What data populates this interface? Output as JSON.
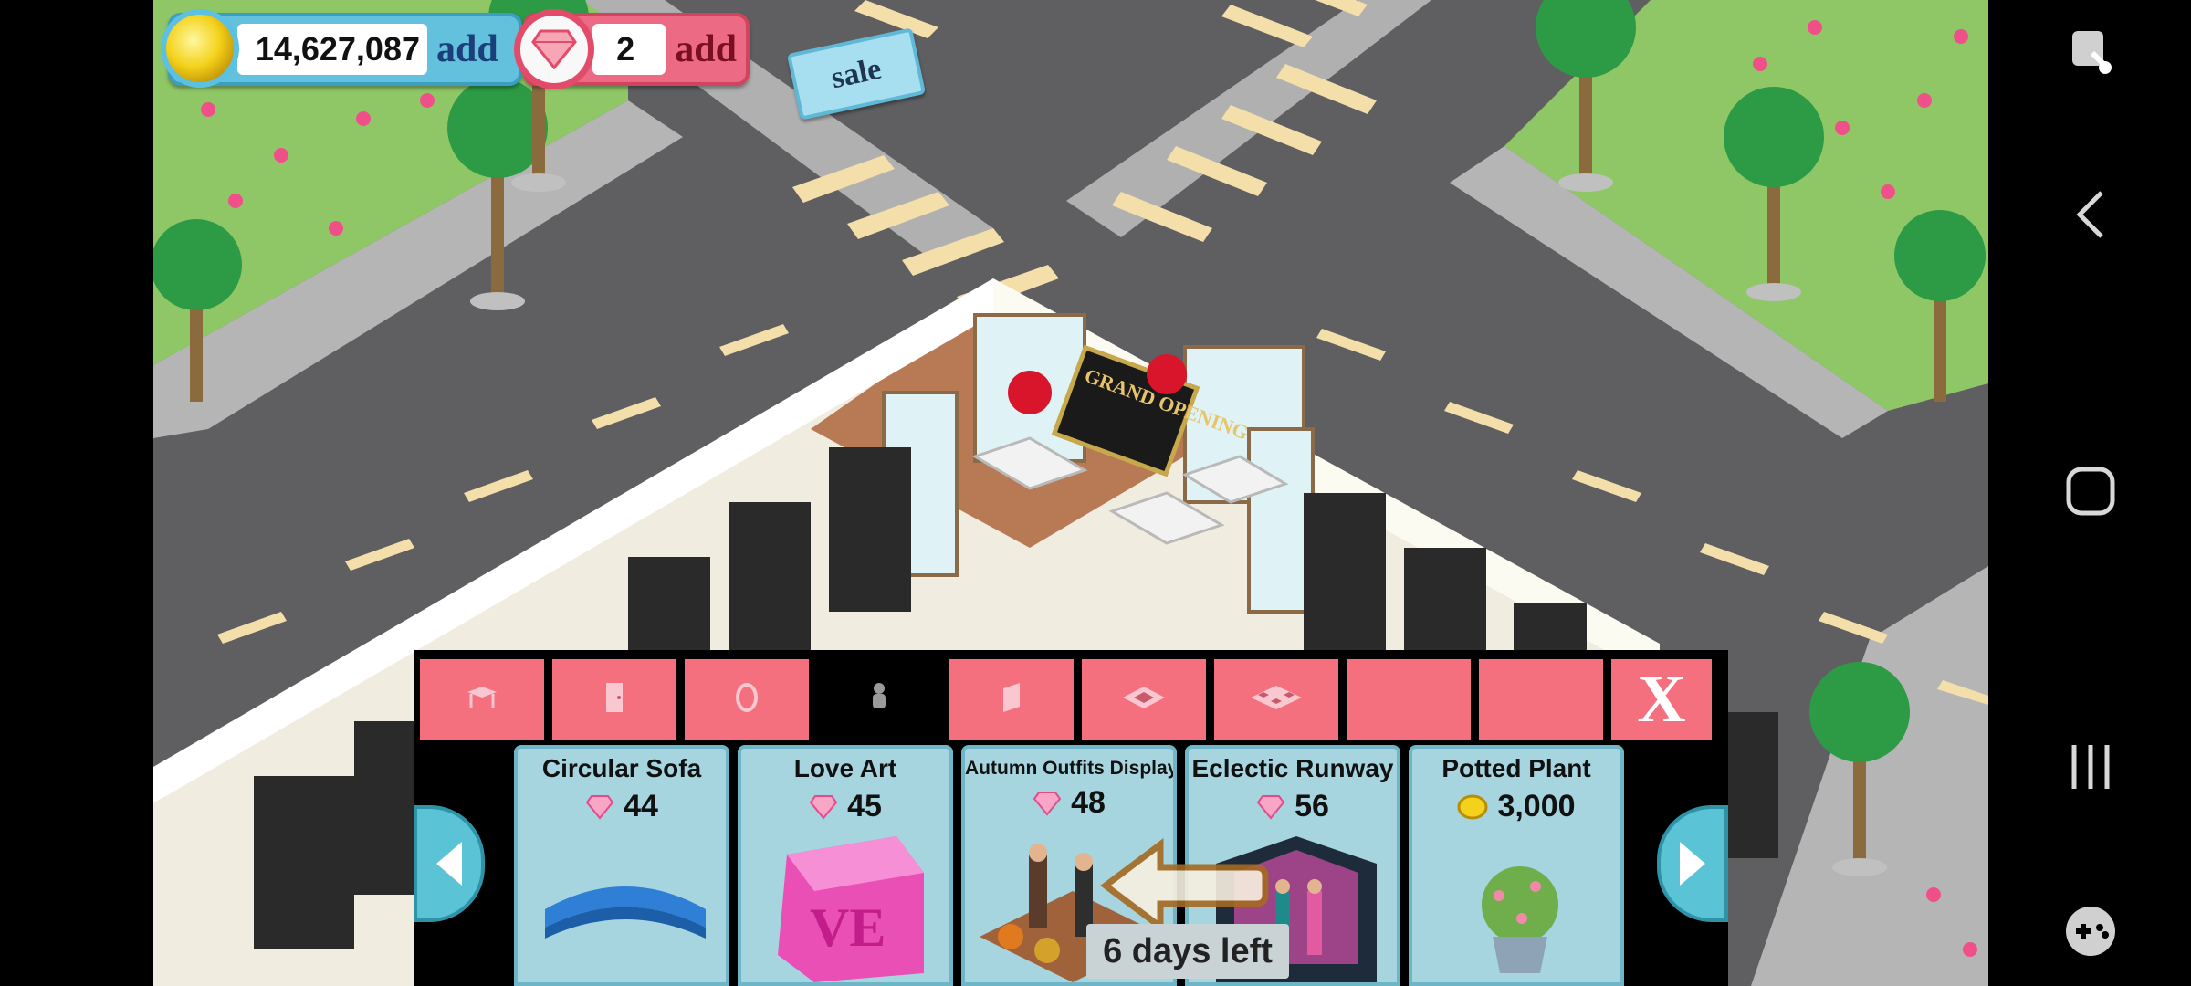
{
  "hud": {
    "coins_value": "14,627,087",
    "coins_add_label": "add",
    "gems_value": "2",
    "gems_add_label": "add",
    "sale_label": "sale"
  },
  "shop": {
    "tabs": [
      {
        "icon": "table-icon",
        "active": false
      },
      {
        "icon": "door-icon",
        "active": false
      },
      {
        "icon": "clock-icon",
        "active": false
      },
      {
        "icon": "mannequin-icon",
        "active": true
      },
      {
        "icon": "wallpaper-icon",
        "active": false
      },
      {
        "icon": "floor-tile-icon",
        "active": false
      },
      {
        "icon": "floor-pattern-icon",
        "active": false
      },
      {
        "icon": "empty-tab",
        "active": false
      },
      {
        "icon": "empty-tab",
        "active": false
      }
    ],
    "close_label": "X",
    "items": [
      {
        "name": "Circular Sofa",
        "currency": "gem",
        "price": "44"
      },
      {
        "name": "Love Art",
        "currency": "gem",
        "price": "45"
      },
      {
        "name": "Autumn Outfits Display",
        "currency": "gem",
        "price": "48"
      },
      {
        "name": "Eclectic Runway",
        "currency": "gem",
        "price": "56"
      },
      {
        "name": "Potted Plant",
        "currency": "coin",
        "price": "3,000"
      }
    ],
    "promo_label": "6 days left"
  },
  "scene": {
    "sign_text": "GRAND OPENING"
  },
  "colors": {
    "tab_pink": "#f5707f",
    "card_blue": "#a6d5e0",
    "coin_blue": "#64c1dd",
    "gem_pink": "#ec6a83"
  }
}
